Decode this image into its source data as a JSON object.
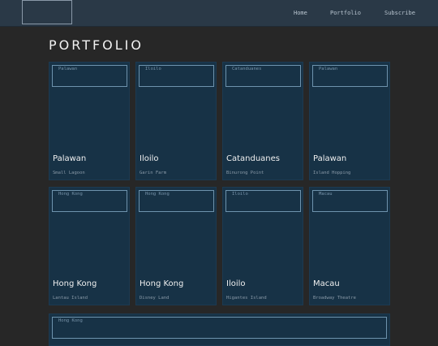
{
  "header": {
    "nav": [
      "Home",
      "Portfolio",
      "Subscribe"
    ]
  },
  "main": {
    "title": "PORTFOLIO",
    "cards": [
      {
        "img_alt": "Palawan",
        "title": "Palawan",
        "subtitle": "Small Lagoon"
      },
      {
        "img_alt": "Iloilo",
        "title": "Iloilo",
        "subtitle": "Garin Farm"
      },
      {
        "img_alt": "Catanduanes",
        "title": "Catanduanes",
        "subtitle": "Binurong Point"
      },
      {
        "img_alt": "Palawan",
        "title": "Palawan",
        "subtitle": "Island Hopping"
      },
      {
        "img_alt": "Hong Kong",
        "title": "Hong Kong",
        "subtitle": "Lantau Island"
      },
      {
        "img_alt": "Hong Kong",
        "title": "Hong Kong",
        "subtitle": "Disney Land"
      },
      {
        "img_alt": "Iloilo",
        "title": "Iloilo",
        "subtitle": "Higantes Island"
      },
      {
        "img_alt": "Macau",
        "title": "Macau",
        "subtitle": "Broadway Theatre"
      }
    ],
    "wide_card": {
      "img_alt": "Hong Kong"
    }
  }
}
